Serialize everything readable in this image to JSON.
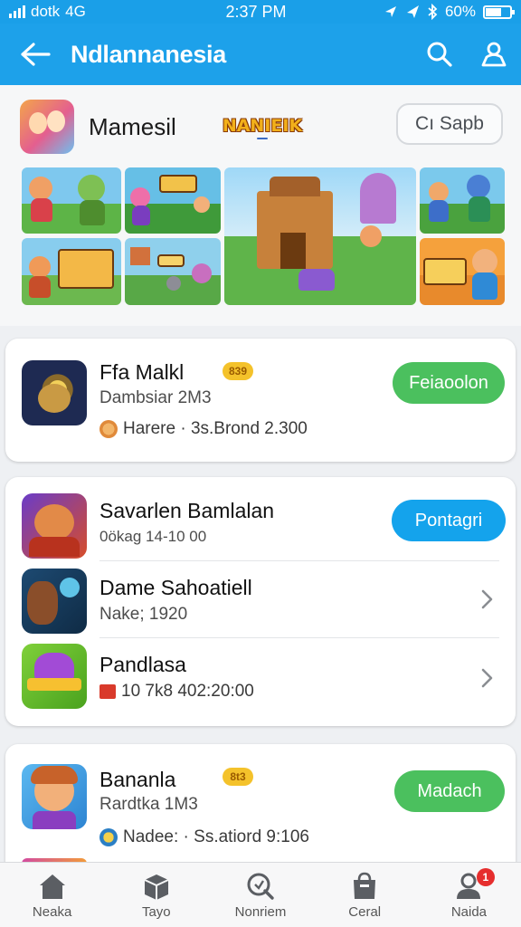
{
  "status_bar": {
    "carrier": "dotk",
    "network": "4G",
    "time": "2:37 PM",
    "battery_text": "60%",
    "battery_level": 0.6
  },
  "app_bar": {
    "title": "Ndlannanesia",
    "back_icon": "arrow-left-icon",
    "search_icon": "search-icon",
    "profile_icon": "user-icon"
  },
  "featured": {
    "name": "Mamesil",
    "logo_text": "NANIEIK",
    "logo_sub": "",
    "search_button": "Cı Sapb",
    "tiles": [
      {
        "name": "game-tile-1",
        "theme": "green"
      },
      {
        "name": "game-tile-2",
        "theme": "jungle"
      },
      {
        "name": "game-tile-3",
        "theme": "castle"
      },
      {
        "name": "game-tile-4",
        "theme": "forest"
      },
      {
        "name": "game-tile-5",
        "theme": "sign"
      },
      {
        "name": "game-tile-6",
        "theme": "village"
      },
      {
        "name": "game-tile-7",
        "theme": "orange"
      }
    ]
  },
  "card1": {
    "name": "Ffa Malkl",
    "badge": "839",
    "subtitle": "Dambsiar 2M3",
    "meta": "Harere · 3s.Brond 2.300",
    "button": "Feiaoolon"
  },
  "card2": {
    "rows": [
      {
        "name": "Savarlen Bamlalan",
        "subtitle": "0ökag 14-10 00",
        "button": "Pontagri"
      },
      {
        "name": "Dame Sahoatiell",
        "subtitle": "Nake; 1920"
      },
      {
        "name": "Pandlasa",
        "subtitle": "10 7k8 402:20:00"
      }
    ]
  },
  "card3": {
    "name": "Bananla",
    "badge": "8t3",
    "subtitle": "Rardtka 1M3",
    "meta": "Nadee: · Ss.atiord 9:106",
    "button": "Madach"
  },
  "bottom_nav": {
    "items": [
      {
        "label": "Neaka",
        "icon": "home-icon"
      },
      {
        "label": "Tayo",
        "icon": "box-icon"
      },
      {
        "label": "Nonriem",
        "icon": "search-refresh-icon"
      },
      {
        "label": "Ceral",
        "icon": "bag-icon"
      },
      {
        "label": "Naida",
        "icon": "profile-icon",
        "badge": "1"
      }
    ]
  },
  "colors": {
    "primary": "#1da1ea",
    "green": "#4bc05e",
    "blue": "#14a3ec",
    "badge": "#f4c22b"
  }
}
